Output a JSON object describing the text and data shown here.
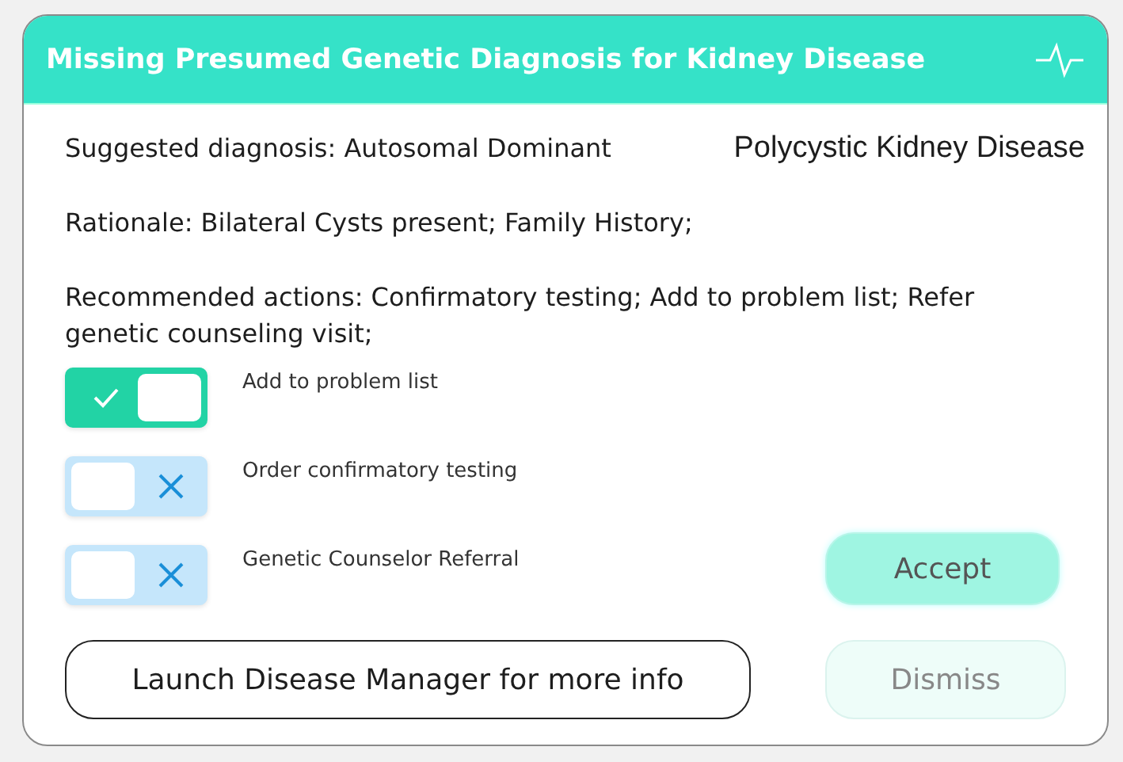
{
  "panel": {
    "title": "Missing Presumed Genetic Diagnosis for Kidney Disease"
  },
  "diagnosis": {
    "label": "Suggested diagnosis: Autosomal Dominant",
    "value": "Polycystic Kidney Disease"
  },
  "rationale": "Rationale: Bilateral Cysts present; Family History;",
  "recommended": "Recommended actions: Confirmatory testing; Add to problem list; Refer genetic counseling visit;",
  "toggles": [
    {
      "label": "Add to problem list",
      "on": true
    },
    {
      "label": "Order confirmatory testing",
      "on": false
    },
    {
      "label": "Genetic Counselor Referral",
      "on": false
    }
  ],
  "buttons": {
    "accept": "Accept",
    "dismiss": "Dismiss",
    "launch": "Launch Disease Manager for more info"
  }
}
